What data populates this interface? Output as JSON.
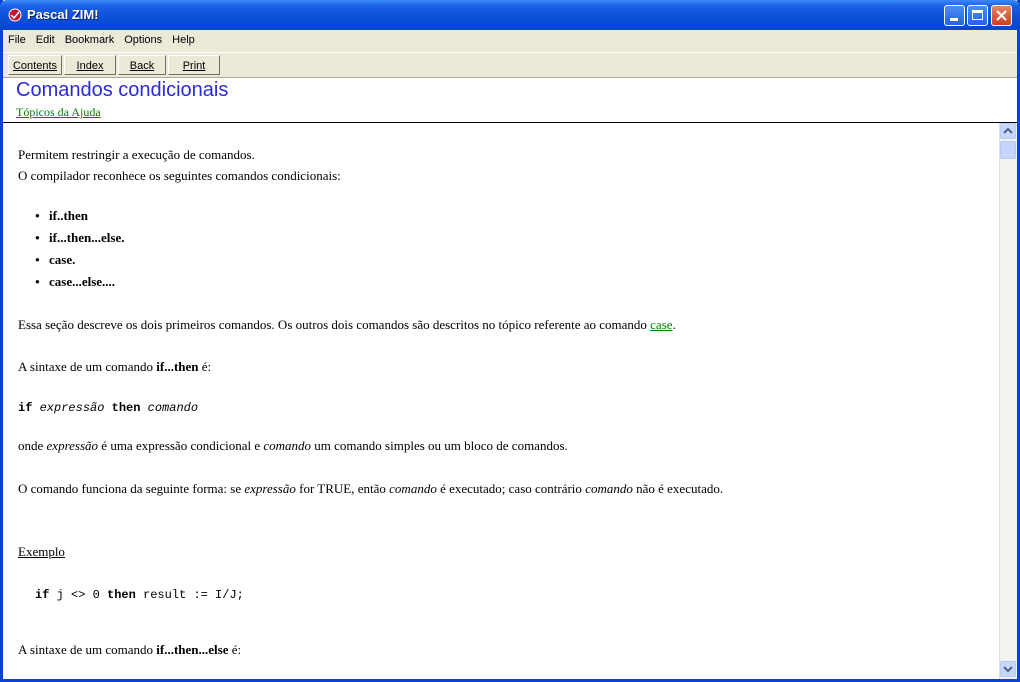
{
  "window": {
    "title": "Pascal ZIM!"
  },
  "menu": [
    "File",
    "Edit",
    "Bookmark",
    "Options",
    "Help"
  ],
  "toolbar": [
    "Contents",
    "Index",
    "Back",
    "Print"
  ],
  "topic": {
    "title": "Comandos condicionais",
    "link": "Tópicos da Ajuda"
  },
  "content": {
    "intro1": "Permitem restringir a execução de comandos.",
    "intro2": "O compilador reconhece os seguintes comandos condicionais:",
    "bullets": [
      "if..then",
      "if...then...else.",
      "case.",
      "case...else...."
    ],
    "section_pre": "Essa seção descreve os dois primeiros comandos. Os outros dois comandos são descritos no tópico referente ao comando ",
    "section_link": "case",
    "section_post": ".",
    "syntax_if_pre": "A sintaxe de um comando ",
    "syntax_if_kw": "if...then",
    "syntax_if_post": " é:",
    "code_if": "if",
    "code_expr": "expressão",
    "code_then": "then",
    "code_cmd": "comando",
    "onde_1": "onde ",
    "onde_expr": "expressão",
    "onde_2": " é uma expressão condicional e ",
    "onde_cmd": "comando",
    "onde_3": " um comando simples ou um bloco de comandos.",
    "func_1": "O comando funciona da seguinte forma: se ",
    "func_expr": "expressão",
    "func_2": " for TRUE, então ",
    "func_cmd": "comando",
    "func_3": " é executado; caso contrário ",
    "func_cmd2": "comando",
    "func_4": " não é executado.",
    "exemplo": "Exemplo",
    "ex_if": "if",
    "ex_mid": " j <> 0 ",
    "ex_then": "then",
    "ex_rest": " result := I/J;",
    "else_pre": "A sintaxe de um comando ",
    "else_kw": "if...then...else",
    "else_post": " é:"
  }
}
